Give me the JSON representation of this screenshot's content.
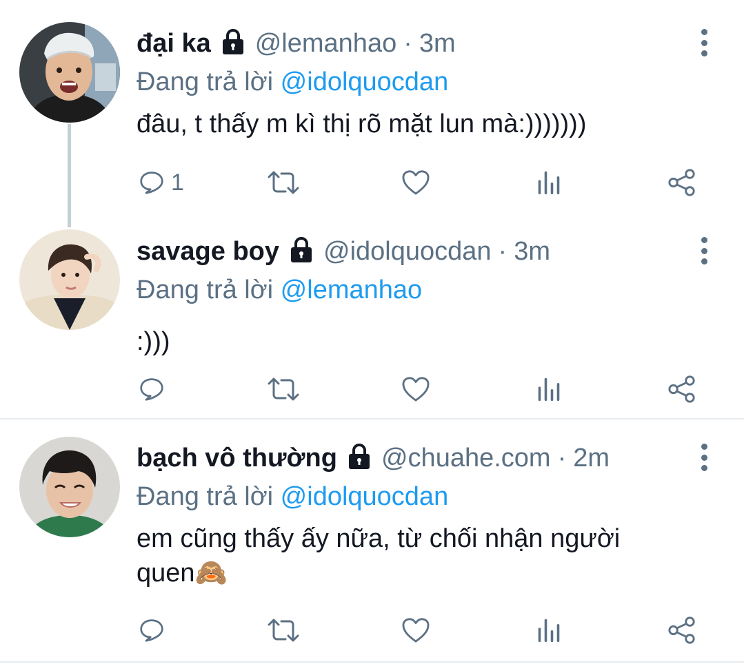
{
  "tweets": [
    {
      "name": "đại ka",
      "handle": "@lemanhao",
      "separator": "·",
      "time": "3m",
      "reply_prefix": "Đang trả lời",
      "reply_to": "@idolquocdan",
      "text": "đâu, t thấy m kì thị rõ mặt lun mà:)))))))",
      "reply_count": "1"
    },
    {
      "name": "savage boy",
      "handle": "@idolquocdan",
      "separator": "·",
      "time": "3m",
      "reply_prefix": "Đang trả lời",
      "reply_to": "@lemanhao",
      "text": ":)))",
      "reply_count": ""
    },
    {
      "name": "bạch vô thường",
      "handle": "@chuahe.com",
      "separator": "·",
      "time": "2m",
      "reply_prefix": "Đang trả lời",
      "reply_to": "@idolquocdan",
      "text_line1": "em cũng thấy ấy nữa, từ chối nhận người",
      "text_line2": "quen🙈",
      "reply_count": ""
    }
  ],
  "icons": {
    "reply": "reply-icon",
    "retweet": "retweet-icon",
    "like": "heart-icon",
    "analytics": "analytics-icon",
    "share": "share-icon",
    "lock": "lock-icon",
    "more": "more-vertical-icon"
  },
  "colors": {
    "text": "#141823",
    "secondary": "#5b7083",
    "link": "#1d9bf0",
    "thread_line": "#c4cfd6"
  }
}
